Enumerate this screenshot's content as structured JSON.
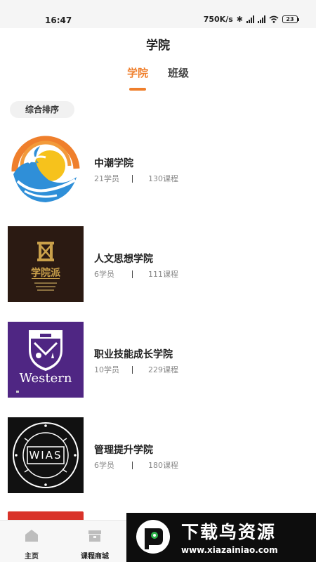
{
  "status_bar": {
    "time": "16:47",
    "speed": "750K/s",
    "battery": "23"
  },
  "page": {
    "title": "学院"
  },
  "tabs": [
    {
      "label": "学院",
      "active": true
    },
    {
      "label": "班级",
      "active": false
    }
  ],
  "sort": {
    "label": "综合排序"
  },
  "colleges": [
    {
      "name": "中潮学院",
      "students": "21学员",
      "courses": "130课程",
      "logo": "wave-sun-logo"
    },
    {
      "name": "人文思想学院",
      "students": "6学员",
      "courses": "111课程",
      "logo": "xueyuanpai-logo",
      "logo_text": "学院派"
    },
    {
      "name": "职业技能成长学院",
      "students": "10学员",
      "courses": "229课程",
      "logo": "western-shield-logo",
      "logo_text": "Western"
    },
    {
      "name": "管理提升学院",
      "students": "6学员",
      "courses": "180课程",
      "logo": "wias-seal-logo",
      "logo_text": "WIAS"
    }
  ],
  "bottom_nav": [
    {
      "label": "主页",
      "icon": "home-icon"
    },
    {
      "label": "课程商城",
      "icon": "store-icon"
    }
  ],
  "watermark": {
    "title": "下载鸟资源",
    "url": "www.xiazainiao.com"
  },
  "colors": {
    "accent": "#ef7f2c",
    "text": "#222222",
    "muted": "#888888"
  }
}
